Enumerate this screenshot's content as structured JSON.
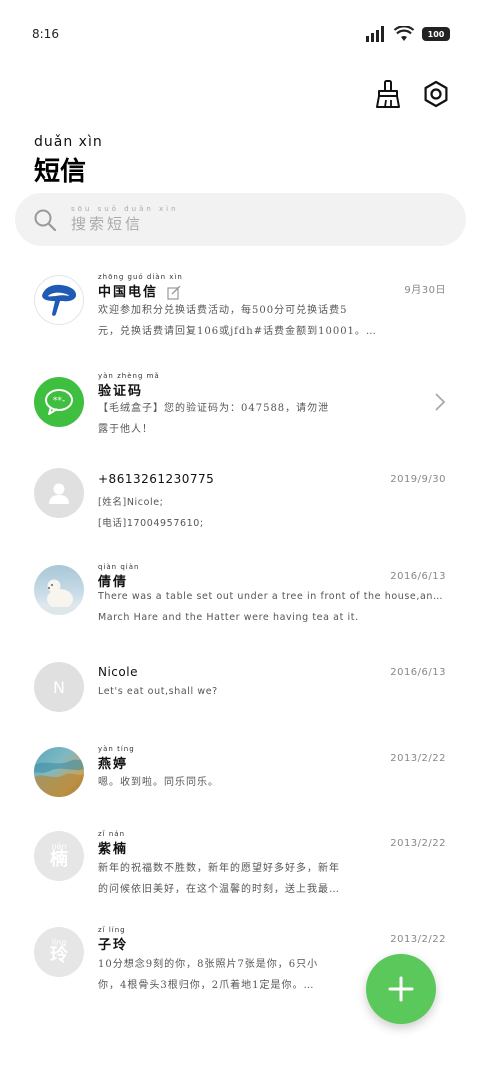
{
  "status_bar": {
    "time": "8:16",
    "battery": "100"
  },
  "header": {
    "title_pinyin": "duǎn xìn",
    "title": "短信"
  },
  "search": {
    "placeholder_pinyin": "sōu suǒ duǎn xìn",
    "placeholder": "搜索短信"
  },
  "conversations": [
    {
      "name_pinyin": "zhōng guó diàn xìn",
      "name": "中国电信",
      "date": "9月30日",
      "line1": "欢迎参加积分兑换话费活动，每500分可兑换话费5",
      "line2": "元，兑换话费请回复106或jfdh#话费金额到10001。…"
    },
    {
      "name_pinyin": "yàn zhèng mǎ",
      "name": "验证码",
      "date": "",
      "line1": "【毛绒盒子】您的验证码为：047588，请勿泄",
      "line2": "露于他人！"
    },
    {
      "name": "+8613261230775",
      "date": "2019/9/30",
      "line1": "[姓名]Nicole;",
      "line2": "[电话]17004957610;"
    },
    {
      "name_pinyin": "qiàn qiàn",
      "name": "倩倩",
      "date": "2016/6/13",
      "line1": "There was a table set out under a tree in front of the house,and the",
      "line2": "March Hare and the Hatter were having tea at it."
    },
    {
      "avatar_letter": "N",
      "name": "Nicole",
      "date": "2016/6/13",
      "line1": "Let's eat out,shall we?"
    },
    {
      "name_pinyin": "yàn tíng",
      "name": "燕婷",
      "date": "2013/2/22",
      "line1": "嗯。收到啦。同乐同乐。"
    },
    {
      "avatar_pinyin": "nán",
      "avatar_char": "楠",
      "name_pinyin": "zǐ nán",
      "name": "紫楠",
      "date": "2013/2/22",
      "line1": "新年的祝福数不胜数，新年的愿望好多好多，新年",
      "line2": "的问候依旧美好，在这个温馨的时刻，送上我最…"
    },
    {
      "avatar_pinyin": "líng",
      "avatar_char": "玲",
      "name_pinyin": "zǐ líng",
      "name": "子玲",
      "date": "2013/2/22",
      "line1": "10分想念9刻的你，8张照片7张是你，6只小",
      "line2": "你，4根骨头3根归你，2爪着地1定是你。…"
    }
  ],
  "colors": {
    "accent": "#5ac85a",
    "telecom_blue": "#1f5bb4",
    "muted_gray": "#e0e0e0"
  }
}
